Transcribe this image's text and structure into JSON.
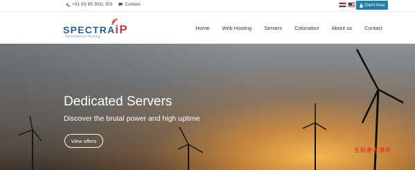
{
  "topbar": {
    "phone": "+31 (0) 85 3011 303",
    "contact": "Contact",
    "client_area": "Client Area",
    "flags": [
      "nl-flag",
      "us-flag"
    ]
  },
  "header": {
    "logo_text": "SPECTRA",
    "logo_suffix": "iP",
    "tagline": "Performance Hosting",
    "nav": [
      "Home",
      "Web Hosting",
      "Servers",
      "Colocation",
      "About us",
      "Contact"
    ]
  },
  "hero": {
    "title": "Dedicated Servers",
    "subtitle": "Discover the brutal power and high uptime",
    "button": "View offers",
    "watermark": "主机参考测评"
  },
  "colors": {
    "accent": "#1f7fa8",
    "brand_blue": "#2c5c8f",
    "brand_red": "#c2363f"
  }
}
